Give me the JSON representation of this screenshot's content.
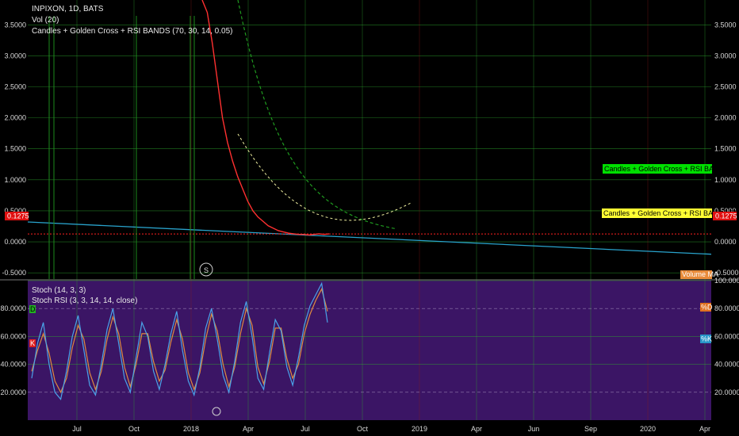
{
  "header": {
    "symbol": "INPIXON, 1D, BATS",
    "vol": "Vol (20)",
    "indicator": "Candles + Golden Cross + RSI BANDS (70, 30, 14, 0.05)"
  },
  "osc_header": {
    "stoch": "Stoch (14, 3, 3)",
    "stoch_rsi": "Stoch RSI (3, 3, 14, 14, close)"
  },
  "labels": {
    "plot1": "Candles + Golden Cross + RSI BANDS:Plot",
    "plot2": "Candles + Golden Cross + RSI BANDS:Plot",
    "volume_ma": "Volume MA",
    "price_tag": "0.1275",
    "pct_d": "%D",
    "pct_k": "%K",
    "s_marker": "S",
    "k_flag": "K",
    "d_flag": "D"
  },
  "colors": {
    "grid": "#2ea82e",
    "osc_bg": "#3b1565",
    "trend_line": "#29a3cc",
    "price_line": "#ff2222",
    "fast_ma": "#ff3030",
    "slow_ma": "#1f9a1f",
    "k_line": "#4aa3e8",
    "d_line": "#e08a40"
  },
  "chart_data": {
    "type": "line",
    "price_axis": {
      "ticks": [
        "3.5000",
        "3.0000",
        "2.5000",
        "2.0000",
        "1.5000",
        "1.0000",
        "0.5000",
        "0.0000",
        "-0.5000"
      ],
      "ylim": [
        -0.6,
        3.9
      ],
      "last_price": 0.1275
    },
    "osc_axis": {
      "left_ticks": [
        "80.0000",
        "60.0000",
        "40.0000",
        "20.0000"
      ],
      "right_ticks": [
        "80.0000",
        "60.0000",
        "40.0000",
        "20.0000"
      ],
      "top_tick": "100.0000",
      "ylim": [
        0,
        100
      ],
      "levels": [
        80,
        20
      ]
    },
    "x_ticks": [
      "Jul",
      "Oct",
      "2018",
      "Apr",
      "Jul",
      "Oct",
      "2019",
      "Apr",
      "Jun",
      "Sep",
      "2020",
      "Apr"
    ],
    "price_series": {
      "name": "Price",
      "points": [
        [
          0,
          3.9
        ],
        [
          0.04,
          3.7
        ],
        [
          0.08,
          3.2
        ],
        [
          0.12,
          2.6
        ],
        [
          0.16,
          2.0
        ],
        [
          0.2,
          1.6
        ],
        [
          0.24,
          1.3
        ],
        [
          0.28,
          1.05
        ],
        [
          0.32,
          0.85
        ],
        [
          0.36,
          0.65
        ],
        [
          0.4,
          0.5
        ],
        [
          0.44,
          0.4
        ],
        [
          0.48,
          0.33
        ],
        [
          0.52,
          0.26
        ],
        [
          0.56,
          0.22
        ],
        [
          0.6,
          0.18
        ],
        [
          0.64,
          0.16
        ],
        [
          0.68,
          0.14
        ],
        [
          0.72,
          0.13
        ],
        [
          0.76,
          0.12
        ],
        [
          0.8,
          0.12
        ],
        [
          0.84,
          0.11
        ],
        [
          0.88,
          0.12
        ],
        [
          0.92,
          0.13
        ],
        [
          0.96,
          0.12
        ],
        [
          1.0,
          0.1275
        ]
      ]
    },
    "stoch_k": [
      30,
      55,
      70,
      40,
      20,
      15,
      35,
      60,
      75,
      50,
      25,
      18,
      40,
      65,
      80,
      55,
      30,
      20,
      45,
      70,
      60,
      35,
      22,
      40,
      62,
      78,
      50,
      28,
      18,
      38,
      66,
      80,
      58,
      32,
      20,
      42,
      70,
      85,
      60,
      30,
      22,
      48,
      72,
      64,
      38,
      25,
      45,
      68,
      82,
      90,
      98,
      70
    ],
    "stoch_d": [
      35,
      50,
      62,
      48,
      28,
      20,
      30,
      52,
      68,
      58,
      34,
      22,
      35,
      58,
      74,
      62,
      38,
      24,
      40,
      62,
      62,
      42,
      28,
      36,
      56,
      72,
      58,
      34,
      22,
      34,
      58,
      76,
      64,
      40,
      24,
      38,
      62,
      80,
      68,
      38,
      26,
      42,
      66,
      66,
      44,
      30,
      40,
      62,
      76,
      86,
      94,
      78
    ]
  }
}
